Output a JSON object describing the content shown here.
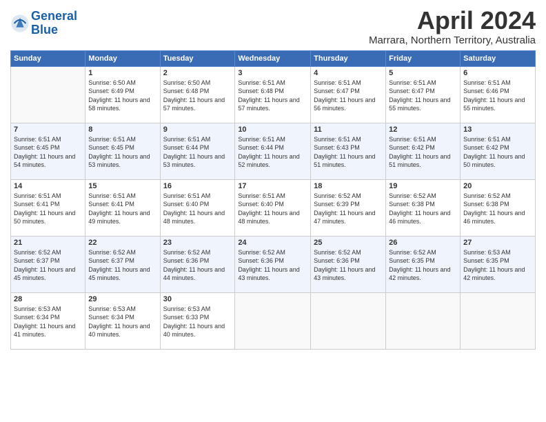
{
  "logo": {
    "line1": "General",
    "line2": "Blue"
  },
  "title": "April 2024",
  "location": "Marrara, Northern Territory, Australia",
  "days_of_week": [
    "Sunday",
    "Monday",
    "Tuesday",
    "Wednesday",
    "Thursday",
    "Friday",
    "Saturday"
  ],
  "weeks": [
    [
      {
        "day": "",
        "sunrise": "",
        "sunset": "",
        "daylight": ""
      },
      {
        "day": "1",
        "sunrise": "Sunrise: 6:50 AM",
        "sunset": "Sunset: 6:49 PM",
        "daylight": "Daylight: 11 hours and 58 minutes."
      },
      {
        "day": "2",
        "sunrise": "Sunrise: 6:50 AM",
        "sunset": "Sunset: 6:48 PM",
        "daylight": "Daylight: 11 hours and 57 minutes."
      },
      {
        "day": "3",
        "sunrise": "Sunrise: 6:51 AM",
        "sunset": "Sunset: 6:48 PM",
        "daylight": "Daylight: 11 hours and 57 minutes."
      },
      {
        "day": "4",
        "sunrise": "Sunrise: 6:51 AM",
        "sunset": "Sunset: 6:47 PM",
        "daylight": "Daylight: 11 hours and 56 minutes."
      },
      {
        "day": "5",
        "sunrise": "Sunrise: 6:51 AM",
        "sunset": "Sunset: 6:47 PM",
        "daylight": "Daylight: 11 hours and 55 minutes."
      },
      {
        "day": "6",
        "sunrise": "Sunrise: 6:51 AM",
        "sunset": "Sunset: 6:46 PM",
        "daylight": "Daylight: 11 hours and 55 minutes."
      }
    ],
    [
      {
        "day": "7",
        "sunrise": "Sunrise: 6:51 AM",
        "sunset": "Sunset: 6:45 PM",
        "daylight": "Daylight: 11 hours and 54 minutes."
      },
      {
        "day": "8",
        "sunrise": "Sunrise: 6:51 AM",
        "sunset": "Sunset: 6:45 PM",
        "daylight": "Daylight: 11 hours and 53 minutes."
      },
      {
        "day": "9",
        "sunrise": "Sunrise: 6:51 AM",
        "sunset": "Sunset: 6:44 PM",
        "daylight": "Daylight: 11 hours and 53 minutes."
      },
      {
        "day": "10",
        "sunrise": "Sunrise: 6:51 AM",
        "sunset": "Sunset: 6:44 PM",
        "daylight": "Daylight: 11 hours and 52 minutes."
      },
      {
        "day": "11",
        "sunrise": "Sunrise: 6:51 AM",
        "sunset": "Sunset: 6:43 PM",
        "daylight": "Daylight: 11 hours and 51 minutes."
      },
      {
        "day": "12",
        "sunrise": "Sunrise: 6:51 AM",
        "sunset": "Sunset: 6:42 PM",
        "daylight": "Daylight: 11 hours and 51 minutes."
      },
      {
        "day": "13",
        "sunrise": "Sunrise: 6:51 AM",
        "sunset": "Sunset: 6:42 PM",
        "daylight": "Daylight: 11 hours and 50 minutes."
      }
    ],
    [
      {
        "day": "14",
        "sunrise": "Sunrise: 6:51 AM",
        "sunset": "Sunset: 6:41 PM",
        "daylight": "Daylight: 11 hours and 50 minutes."
      },
      {
        "day": "15",
        "sunrise": "Sunrise: 6:51 AM",
        "sunset": "Sunset: 6:41 PM",
        "daylight": "Daylight: 11 hours and 49 minutes."
      },
      {
        "day": "16",
        "sunrise": "Sunrise: 6:51 AM",
        "sunset": "Sunset: 6:40 PM",
        "daylight": "Daylight: 11 hours and 48 minutes."
      },
      {
        "day": "17",
        "sunrise": "Sunrise: 6:51 AM",
        "sunset": "Sunset: 6:40 PM",
        "daylight": "Daylight: 11 hours and 48 minutes."
      },
      {
        "day": "18",
        "sunrise": "Sunrise: 6:52 AM",
        "sunset": "Sunset: 6:39 PM",
        "daylight": "Daylight: 11 hours and 47 minutes."
      },
      {
        "day": "19",
        "sunrise": "Sunrise: 6:52 AM",
        "sunset": "Sunset: 6:38 PM",
        "daylight": "Daylight: 11 hours and 46 minutes."
      },
      {
        "day": "20",
        "sunrise": "Sunrise: 6:52 AM",
        "sunset": "Sunset: 6:38 PM",
        "daylight": "Daylight: 11 hours and 46 minutes."
      }
    ],
    [
      {
        "day": "21",
        "sunrise": "Sunrise: 6:52 AM",
        "sunset": "Sunset: 6:37 PM",
        "daylight": "Daylight: 11 hours and 45 minutes."
      },
      {
        "day": "22",
        "sunrise": "Sunrise: 6:52 AM",
        "sunset": "Sunset: 6:37 PM",
        "daylight": "Daylight: 11 hours and 45 minutes."
      },
      {
        "day": "23",
        "sunrise": "Sunrise: 6:52 AM",
        "sunset": "Sunset: 6:36 PM",
        "daylight": "Daylight: 11 hours and 44 minutes."
      },
      {
        "day": "24",
        "sunrise": "Sunrise: 6:52 AM",
        "sunset": "Sunset: 6:36 PM",
        "daylight": "Daylight: 11 hours and 43 minutes."
      },
      {
        "day": "25",
        "sunrise": "Sunrise: 6:52 AM",
        "sunset": "Sunset: 6:36 PM",
        "daylight": "Daylight: 11 hours and 43 minutes."
      },
      {
        "day": "26",
        "sunrise": "Sunrise: 6:52 AM",
        "sunset": "Sunset: 6:35 PM",
        "daylight": "Daylight: 11 hours and 42 minutes."
      },
      {
        "day": "27",
        "sunrise": "Sunrise: 6:53 AM",
        "sunset": "Sunset: 6:35 PM",
        "daylight": "Daylight: 11 hours and 42 minutes."
      }
    ],
    [
      {
        "day": "28",
        "sunrise": "Sunrise: 6:53 AM",
        "sunset": "Sunset: 6:34 PM",
        "daylight": "Daylight: 11 hours and 41 minutes."
      },
      {
        "day": "29",
        "sunrise": "Sunrise: 6:53 AM",
        "sunset": "Sunset: 6:34 PM",
        "daylight": "Daylight: 11 hours and 40 minutes."
      },
      {
        "day": "30",
        "sunrise": "Sunrise: 6:53 AM",
        "sunset": "Sunset: 6:33 PM",
        "daylight": "Daylight: 11 hours and 40 minutes."
      },
      {
        "day": "",
        "sunrise": "",
        "sunset": "",
        "daylight": ""
      },
      {
        "day": "",
        "sunrise": "",
        "sunset": "",
        "daylight": ""
      },
      {
        "day": "",
        "sunrise": "",
        "sunset": "",
        "daylight": ""
      },
      {
        "day": "",
        "sunrise": "",
        "sunset": "",
        "daylight": ""
      }
    ]
  ]
}
